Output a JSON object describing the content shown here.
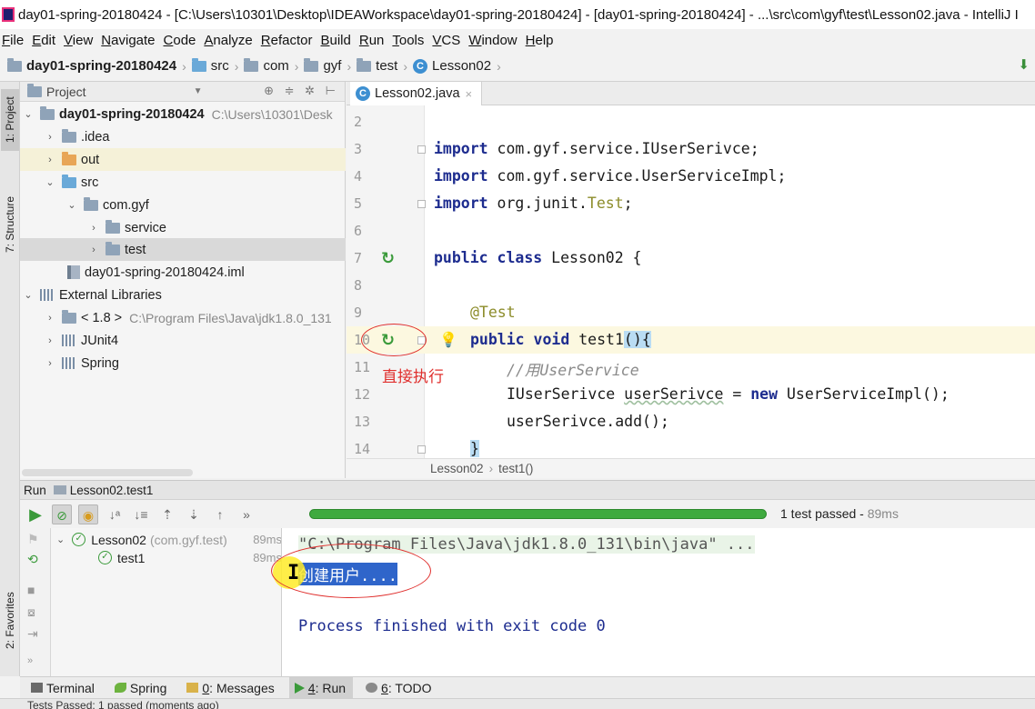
{
  "window": {
    "title": "day01-spring-20180424 - [C:\\Users\\10301\\Desktop\\IDEAWorkspace\\day01-spring-20180424] - [day01-spring-20180424] - ...\\src\\com\\gyf\\test\\Lesson02.java - IntelliJ I"
  },
  "menu": [
    "File",
    "Edit",
    "View",
    "Navigate",
    "Code",
    "Analyze",
    "Refactor",
    "Build",
    "Run",
    "Tools",
    "VCS",
    "Window",
    "Help"
  ],
  "breadcrumb": [
    "day01-spring-20180424",
    "src",
    "com",
    "gyf",
    "test",
    "Lesson02"
  ],
  "left_strip": {
    "project": "1: Project",
    "structure": "7: Structure",
    "favorites": "2: Favorites"
  },
  "project_panel": {
    "header": "Project",
    "tree": {
      "root": "day01-spring-20180424",
      "root_path": "C:\\Users\\10301\\Desk",
      "idea": ".idea",
      "out": "out",
      "src": "src",
      "comgyf": "com.gyf",
      "service": "service",
      "test": "test",
      "iml": "day01-spring-20180424.iml",
      "ext": "External Libraries",
      "jdk": "< 1.8 >",
      "jdk_path": "C:\\Program Files\\Java\\jdk1.8.0_131",
      "junit": "JUnit4",
      "spring": "Spring"
    }
  },
  "editor": {
    "tab_label": "Lesson02.java",
    "line_numbers": [
      "2",
      "3",
      "4",
      "5",
      "6",
      "7",
      "8",
      "9",
      "10",
      "11",
      "12",
      "13",
      "14"
    ],
    "code": {
      "import_kw": "import",
      "l3_rest": " com.gyf.service.IUserSerivce;",
      "l4_rest": " com.gyf.service.UserServiceImpl;",
      "l5_rest": " org.junit.",
      "l5_cls": "Test",
      "l5_end": ";",
      "public_class": "public class",
      "class_name": " Lesson02 {",
      "annotation": "@Test",
      "public_void": "public void",
      "method": " test1",
      "parens": "()",
      "open_brace": "{",
      "comment": "//用UserService",
      "l12_type": "IUserSerivce ",
      "l12_var": "userSerivce",
      "l12_eq": " = ",
      "new_kw": "new",
      "l12_rest": " UserServiceImpl();",
      "l13": "userSerivce.add();",
      "l14": "}"
    },
    "annotation_text": "直接执行",
    "breadcrumb": {
      "class": "Lesson02",
      "method": "test1()"
    }
  },
  "run_panel": {
    "label": "Run",
    "config": "Lesson02.test1",
    "status_text": "1 test passed",
    "status_time": "89ms",
    "progress": 1.0,
    "tests": {
      "suite": "Lesson02",
      "suite_pkg": "(com.gyf.test)",
      "suite_time": "89ms",
      "case": "test1",
      "case_time": "89ms"
    },
    "console": {
      "cmd": "\"C:\\Program Files\\Java\\jdk1.8.0_131\\bin\\java\" ...",
      "output": "创建用户....",
      "exit": "Process finished with exit code 0"
    }
  },
  "bottom_tabs": {
    "terminal": "Terminal",
    "spring": "Spring",
    "messages_num": "0",
    "messages": ": Messages",
    "run_num": "4",
    "run": ": Run",
    "todo_num": "6",
    "todo": ": TODO"
  },
  "status_bar": "Tests Passed: 1 passed (moments ago)",
  "colors": {
    "keyword": "#1d2c8f",
    "annotation": "#8c8c2a",
    "pass_green": "#3faa3f",
    "annotation_red": "#e0302e",
    "selection_blue": "#2f65ca"
  }
}
